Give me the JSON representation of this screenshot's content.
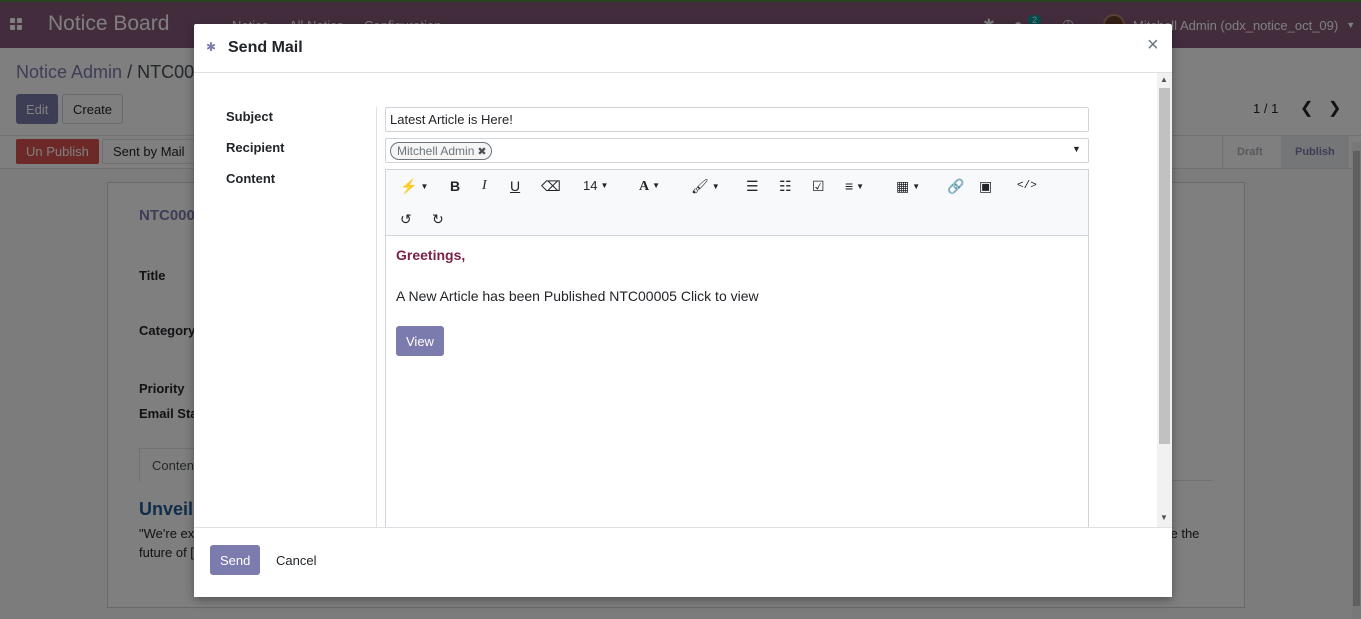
{
  "app": {
    "brand": "Notice Board",
    "menu": [
      "Notice",
      "All Notice",
      "Configuration"
    ],
    "user": "Mitchell Admin (odx_notice_oct_09)",
    "chat_count": "2"
  },
  "control_panel": {
    "breadcrumb_parent": "Notice Admin",
    "breadcrumb_sep": "/",
    "breadcrumb_current": "NTC00",
    "edit_label": "Edit",
    "create_label": "Create",
    "pager": "1 / 1"
  },
  "statusbar": {
    "unpublish_label": "Un Publish",
    "sent_by_mail_label": "Sent by Mail",
    "stages": [
      "Draft",
      "Publish"
    ]
  },
  "sheet": {
    "ref": "NTC000",
    "title_label": "Title",
    "category_label": "Category",
    "priority_label": "Priority",
    "email_status_label": "Email Sta",
    "tab_content": "Conten",
    "heading": "Unveil",
    "text1": "\"We're ex",
    "text2": "future of [",
    "text_right": "ce the"
  },
  "dialog": {
    "title": "Send Mail",
    "close": "×",
    "subject_label": "Subject",
    "recipient_label": "Recipient",
    "content_label": "Content",
    "subject_value": "Latest Article is Here!",
    "recipient_tag": "Mitchell Admin",
    "font_size": "14",
    "greeting": "Greetings,",
    "message": "A New Article has been Published NTC00005 Click to view",
    "view_label": "View",
    "send_label": "Send",
    "cancel_label": "Cancel"
  },
  "colors": {
    "brand": "#875a7b",
    "primary": "#7c7bad",
    "danger": "#d9534f",
    "greeting": "#7b2149"
  }
}
